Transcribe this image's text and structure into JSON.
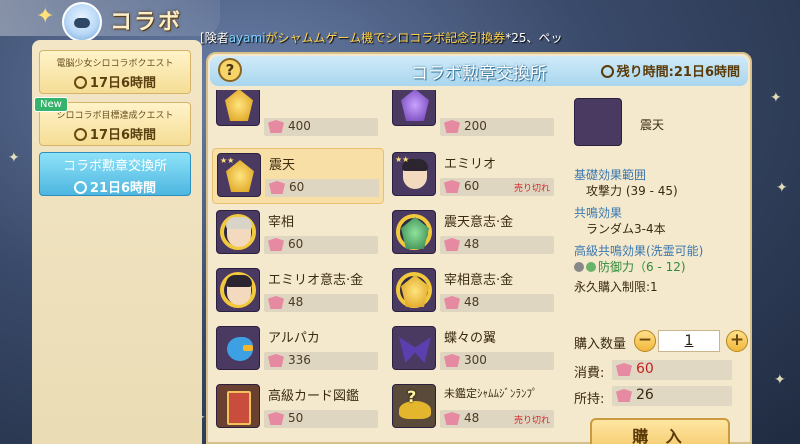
{
  "header": {
    "title": "コラボ",
    "ticker": {
      "pre": "[",
      "role": "険者",
      "user": "ayami",
      "mid": "がシャムムゲーム機でシロコラボ記念引換券",
      "post": "*25、ペッ"
    }
  },
  "sidebar": {
    "items": [
      {
        "label": "電脳少女シロコラボクエスト",
        "time": "17日6時間",
        "new": false,
        "active": false
      },
      {
        "label": "シロコラボ目標達成クエスト",
        "time": "17日6時間",
        "new": true,
        "new_label": "New",
        "active": false
      },
      {
        "label": "コラボ勲章交換所",
        "time": "21日6時間",
        "new": false,
        "active": true
      }
    ]
  },
  "panel": {
    "help": "?",
    "title": "コラボ勲章交換所",
    "remaining_label": "残り時間:",
    "remaining_value": "21日6時間"
  },
  "items": [
    {
      "name": "",
      "price": "400",
      "soldout": ""
    },
    {
      "name": "",
      "price": "200",
      "soldout": ""
    },
    {
      "name": "震天",
      "price": "60",
      "soldout": ""
    },
    {
      "name": "エミリオ",
      "price": "60",
      "soldout": "売り切れ"
    },
    {
      "name": "宰相",
      "price": "60",
      "soldout": ""
    },
    {
      "name": "震天意志·金",
      "price": "48",
      "soldout": ""
    },
    {
      "name": "エミリオ意志·金",
      "price": "48",
      "soldout": ""
    },
    {
      "name": "宰相意志·金",
      "price": "48",
      "soldout": ""
    },
    {
      "name": "アルパカ",
      "price": "336",
      "soldout": ""
    },
    {
      "name": "蝶々の翼",
      "price": "300",
      "soldout": ""
    },
    {
      "name": "高級カード図鑑",
      "price": "50",
      "soldout": ""
    },
    {
      "name": "未鑑定ｼｬﾑﾑｼﾞﾝﾗﾝﾌﾟ",
      "price": "48",
      "soldout": "売り切れ"
    }
  ],
  "detail": {
    "name": "震天",
    "base_label": "基礎効果範囲",
    "base_value": "攻撃力 (39 - 45)",
    "resonance_label": "共鳴効果",
    "resonance_value": "ランダム3-4本",
    "advanced_label": "高級共鳴効果(洗霊可能)",
    "advanced_value": "防御力（6 - 12)",
    "limit": "永久購入制限:1",
    "qty_label": "購入数量",
    "qty_minus": "−",
    "qty_plus": "+",
    "qty_value": "1",
    "cost_label": "消費:",
    "cost_value": "60",
    "owned_label": "所持:",
    "owned_value": "26",
    "buy_label": "購 入"
  },
  "colors": {
    "accent": "#4db6e0",
    "soldout": "#d02a2a",
    "cost": "#c82020"
  }
}
